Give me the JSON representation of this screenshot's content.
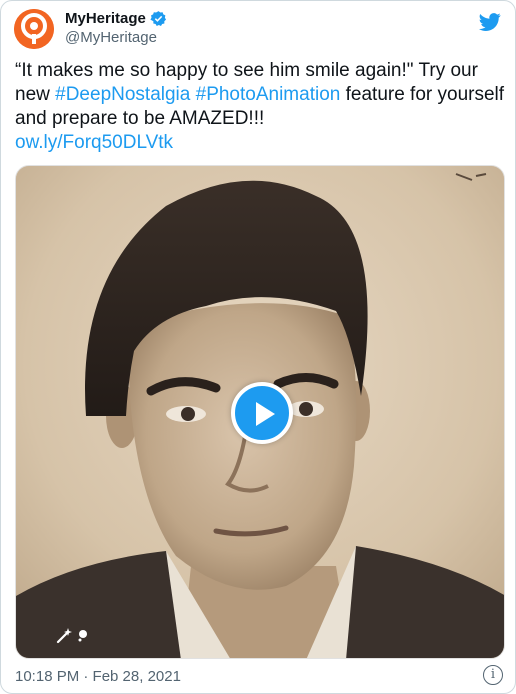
{
  "author": {
    "name": "MyHeritage",
    "handle": "@MyHeritage",
    "verified": true,
    "brand_color": "#f26522"
  },
  "tweet": {
    "text_before": "“It makes me so happy to see him smile again!\" Try our new ",
    "hashtag_1": "#DeepNostalgia",
    "text_between": " ",
    "hashtag_2": "#PhotoAnimation",
    "text_after": " feature for yourself and prepare to be AMAZED!!!",
    "short_link": "ow.ly/Forq50DLVtk",
    "link_color": "#1d9bf0"
  },
  "media": {
    "type": "video",
    "play_icon": "play-icon",
    "overlay_icon": "magic-wand-icon"
  },
  "footer": {
    "timestamp": "10:18 PM · Feb 28, 2021",
    "info_icon": "info-icon",
    "info_glyph": "i"
  },
  "icons": {
    "platform": "twitter-bird-icon",
    "verified": "verified-badge-icon"
  }
}
